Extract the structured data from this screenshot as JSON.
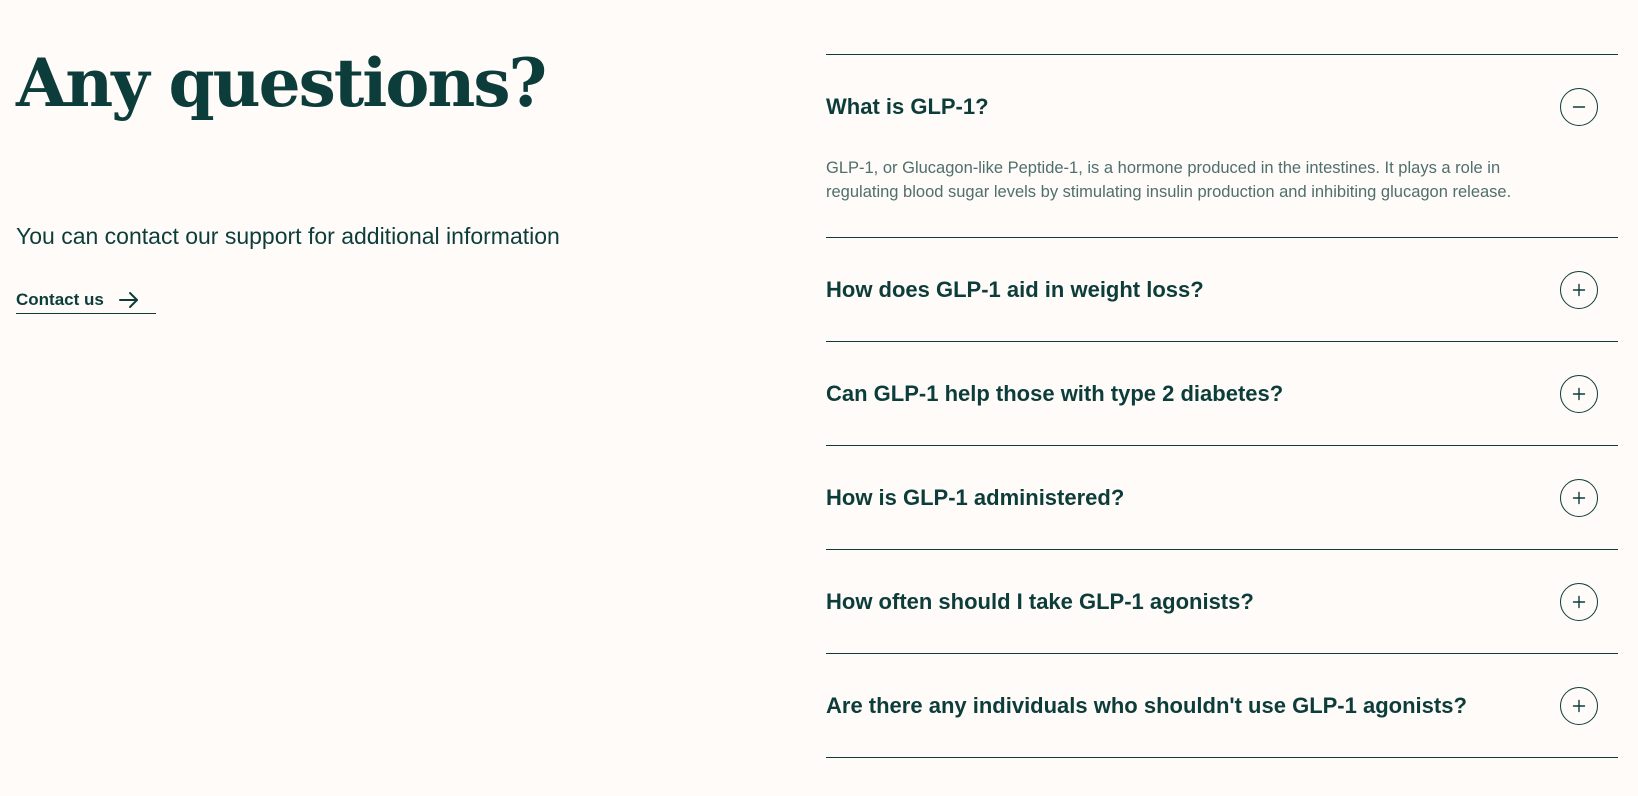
{
  "left": {
    "heading": "Any questions?",
    "subtext": "You can contact our support for additional information",
    "contact": {
      "label": "Contact us",
      "icon": "arrow-right-icon"
    }
  },
  "colors": {
    "background": "#fefbf8",
    "primary": "#0d3d3a",
    "answer_text": "#4f6f6c"
  },
  "faq": {
    "items": [
      {
        "question": "What is GLP-1?",
        "answer": "GLP-1, or Glucagon-like Peptide-1, is a hormone produced in the intestines. It plays a role in regulating blood sugar levels by stimulating insulin production and inhibiting glucagon release.",
        "expanded": true,
        "icon": "minus-circle-icon"
      },
      {
        "question": "How does GLP-1 aid in weight loss?",
        "expanded": false,
        "icon": "plus-circle-icon"
      },
      {
        "question": "Can GLP-1 help those with type 2 diabetes?",
        "expanded": false,
        "icon": "plus-circle-icon"
      },
      {
        "question": "How is GLP-1 administered?",
        "expanded": false,
        "icon": "plus-circle-icon"
      },
      {
        "question": "How often should I take GLP-1 agonists?",
        "expanded": false,
        "icon": "plus-circle-icon"
      },
      {
        "question": "Are there any individuals who shouldn't use GLP-1 agonists?",
        "expanded": false,
        "icon": "plus-circle-icon"
      }
    ]
  }
}
